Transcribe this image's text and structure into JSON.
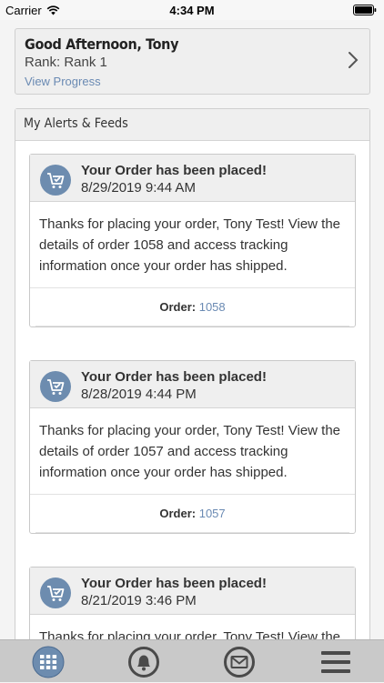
{
  "status_bar": {
    "carrier": "Carrier",
    "time": "4:34 PM"
  },
  "greeting": {
    "title": "Good Afternoon, Tony",
    "rank": "Rank: Rank 1",
    "progress_link": "View Progress"
  },
  "feeds": {
    "header": "My Alerts & Feeds",
    "cards": [
      {
        "title": "Your Order has been placed!",
        "date": "8/29/2019 9:44 AM",
        "body": "Thanks for placing your order, Tony Test! View the details of order 1058 and access tracking information once your order has shipped.",
        "order_label": "Order:",
        "order_number": "1058"
      },
      {
        "title": "Your Order has been placed!",
        "date": "8/28/2019 4:44 PM",
        "body": "Thanks for placing your order, Tony Test! View the details of order 1057 and access tracking information once your order has shipped.",
        "order_label": "Order:",
        "order_number": "1057"
      },
      {
        "title": "Your Order has been placed!",
        "date": "8/21/2019 3:46 PM",
        "body": "Thanks for placing your order, Tony Test! View the",
        "order_label": "",
        "order_number": ""
      }
    ]
  },
  "tabbar": {
    "items": [
      {
        "icon": "grid-icon"
      },
      {
        "icon": "bell-icon"
      },
      {
        "icon": "mail-icon"
      },
      {
        "icon": "menu-icon"
      }
    ]
  },
  "colors": {
    "accent": "#6a8ab3",
    "icon_bg": "#6d8caf",
    "tab_icon": "#4a4a4a"
  }
}
